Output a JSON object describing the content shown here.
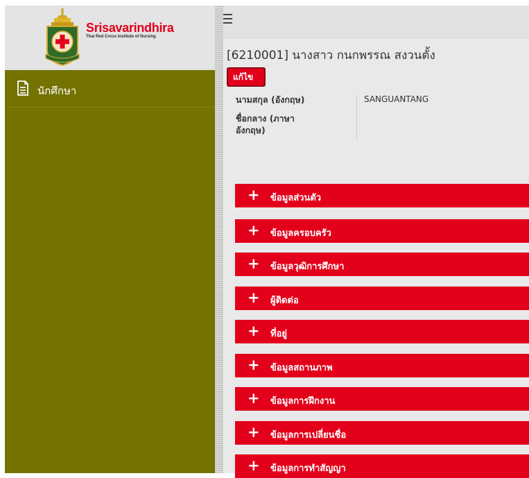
{
  "logo": {
    "title": "Srisavarindhira",
    "subtitle": "Thai Red Cross Institute of Nursing"
  },
  "sidebar": {
    "items": [
      {
        "label": "นักศึกษา",
        "icon": "document-icon"
      }
    ]
  },
  "header": {
    "student_title": "[6210001] นางสาว กนกพรรณ สงวนตั้ง",
    "edit_label": "แก้ไข"
  },
  "info": {
    "fields": [
      {
        "label": "นามสกุล (อังกฤษ)",
        "value": "SANGUANTANG"
      },
      {
        "label_line1": "ชื่อกลาง (ภาษา",
        "label_line2": "อังกฤษ)",
        "value": ""
      }
    ]
  },
  "sections": [
    "ข้อมูลส่วนตัว",
    "ข้อมูลครอบครัว",
    "ข้อมูลวุฒิการศึกษา",
    "ผู้ติดต่อ",
    "ที่อยู่",
    "ข้อมูลสถานภาพ",
    "ข้อมูลการฝึกงาน",
    "ข้อมูลการเปลี่ยนชื่อ",
    "ข้อมูลการทำสัญญา"
  ],
  "colors": {
    "sidebar": "#747200",
    "accent": "#e3001b",
    "logo_bg": "#e4e4e4",
    "main_bg": "#e9e9e9"
  }
}
